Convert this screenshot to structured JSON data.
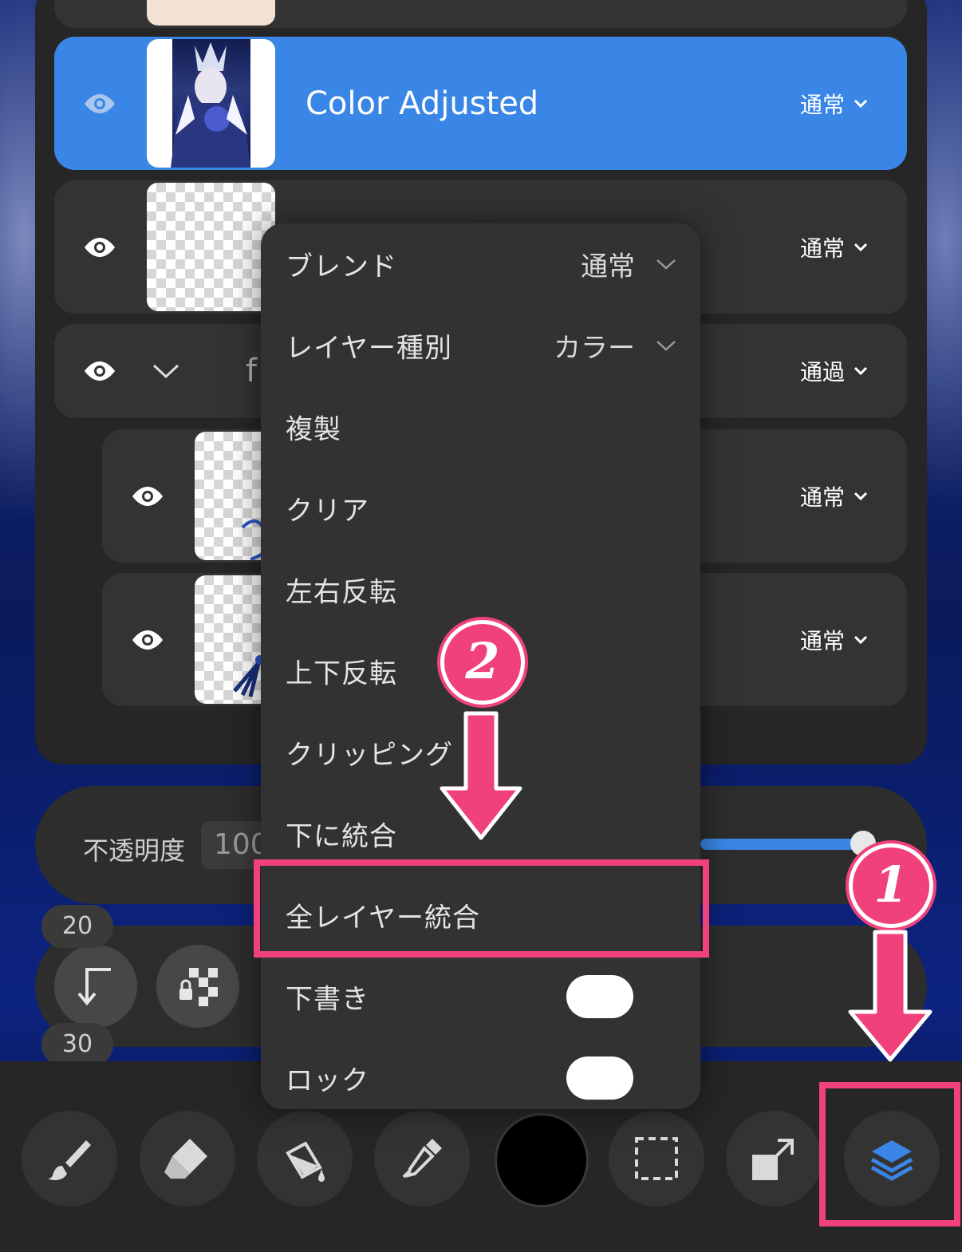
{
  "layers": {
    "top_partial": {
      "blend": ""
    },
    "selected": {
      "name": "Color Adjusted",
      "blend": "通常"
    },
    "row2": {
      "blend": "通常"
    },
    "folder": {
      "name_partial": "f",
      "blend": "通過"
    },
    "child1": {
      "blend": "通常"
    },
    "child2": {
      "blend": "通常"
    }
  },
  "opacity": {
    "label": "不透明度",
    "value": "100",
    "level_percent": 100
  },
  "brush_sizes": {
    "first": "20",
    "second": "30"
  },
  "menu": {
    "items": [
      {
        "label": "ブレンド",
        "value": "通常"
      },
      {
        "label": "レイヤー種別",
        "value": "カラー"
      },
      {
        "label": "複製"
      },
      {
        "label": "クリア"
      },
      {
        "label": "左右反転"
      },
      {
        "label": "上下反転"
      },
      {
        "label": "クリッピング"
      },
      {
        "label": "下に統合"
      },
      {
        "label": "全レイヤー統合"
      },
      {
        "label": "下書き",
        "toggle": true
      },
      {
        "label": "ロック",
        "toggle": true
      }
    ]
  },
  "annotations": {
    "step1": "1",
    "step2": "2",
    "color": "#f0417a"
  },
  "toolbar": {
    "tools": [
      "brush-icon",
      "eraser-icon",
      "fill-bucket-icon",
      "eyedropper-icon",
      "color-swatch",
      "selection-icon",
      "transform-icon",
      "layers-icon"
    ],
    "current_color": "#000000",
    "accent": "#3a86e6"
  }
}
